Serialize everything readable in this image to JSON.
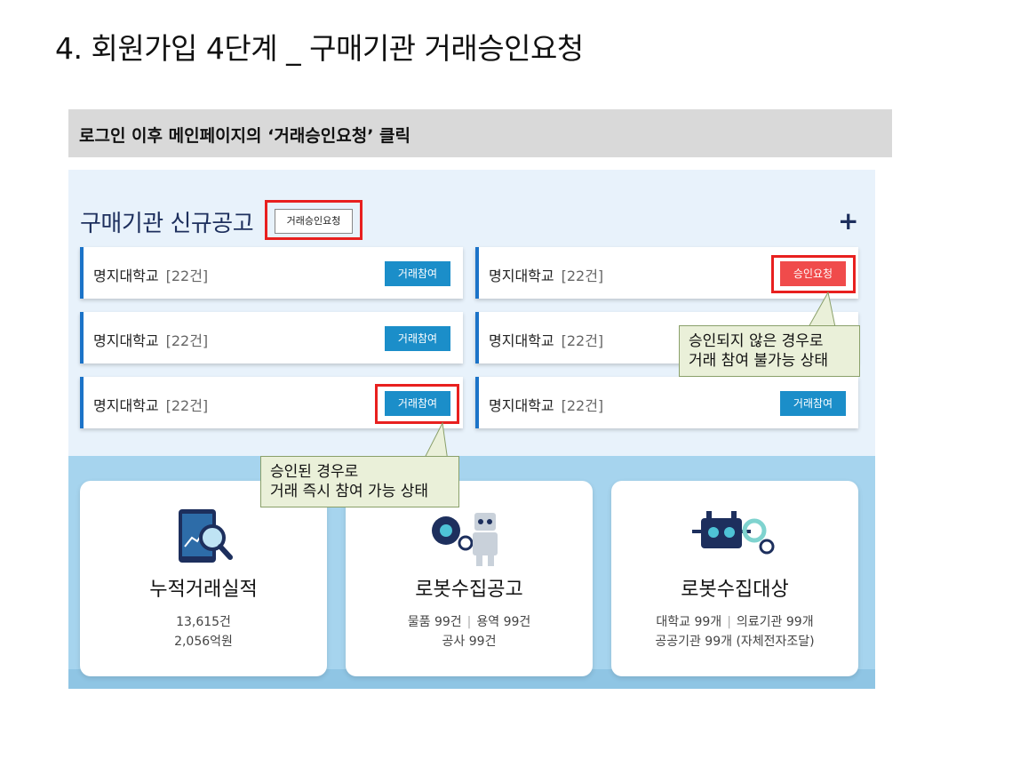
{
  "slide": {
    "title": "4. 회원가입 4단계 _ 구매기관 거래승인요청",
    "instruction": "로그인 이후 메인페이지의 ‘거래승인요청’ 클릭"
  },
  "section": {
    "title": "구매기관 신규공고",
    "approval_button": "거래승인요청",
    "plus": "+"
  },
  "cards": [
    {
      "name": "명지대학교",
      "count": "[22건]",
      "button": "거래참여"
    },
    {
      "name": "명지대학교",
      "count": "[22건]",
      "button": "승인요청"
    },
    {
      "name": "명지대학교",
      "count": "[22건]",
      "button": "거래참여"
    },
    {
      "name": "명지대학교",
      "count": "[22건]",
      "button": ""
    },
    {
      "name": "명지대학교",
      "count": "[22건]",
      "button": "거래참여"
    },
    {
      "name": "명지대학교",
      "count": "[22건]",
      "button": "거래참여"
    }
  ],
  "callouts": {
    "not_approved": [
      "승인되지 않은 경우로",
      "거래 참여 불가능 상태"
    ],
    "approved": [
      "승인된 경우로",
      "거래 즉시 참여 가능 상태"
    ]
  },
  "stats": [
    {
      "label": "누적거래실적",
      "line1": "13,615건",
      "line2": "2,056억원",
      "icon": "tablet-chart-search-icon"
    },
    {
      "label": "로봇수집공고",
      "line1a": "물품 99건",
      "line1b": "용역 99건",
      "line2": "공사 99건",
      "icon": "robot-gear-icon"
    },
    {
      "label": "로봇수집대상",
      "line1a": "대학교 99개",
      "line1b": "의료기관 99개",
      "line2": "공공기관 99개 (자체전자조달)",
      "icon": "robot-head-gear-icon"
    }
  ],
  "colors": {
    "join_button": "#1b8ec9",
    "request_button": "#f04b4b",
    "highlight": "#e8201f",
    "callout_bg": "#eaf0d9"
  }
}
